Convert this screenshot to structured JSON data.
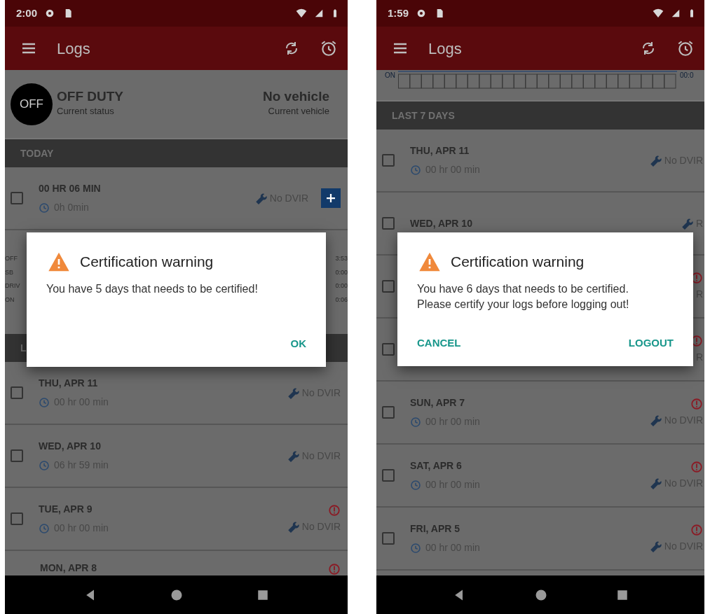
{
  "phones": [
    {
      "status_bar": {
        "time": "2:00"
      },
      "app_bar": {
        "title": "Logs"
      },
      "blocks": [
        {
          "kind": "status_card",
          "badge": "OFF",
          "status": "OFF DUTY",
          "status_caption": "Current status",
          "vehicle": "No vehicle",
          "vehicle_caption": "Current vehicle"
        },
        {
          "kind": "header",
          "text": "TODAY"
        },
        {
          "kind": "log_row",
          "date": "00 HR  06 MIN",
          "duration": "0h 0min",
          "dvir": "No DVIR",
          "alert": false,
          "checked": false,
          "add": true
        },
        {
          "kind": "summary_strip",
          "left_labels": [
            "OFF",
            "SB",
            "DRIV",
            "ON"
          ],
          "right_values": [
            "3:53",
            "0:00",
            "0:00",
            "0:06"
          ]
        },
        {
          "kind": "header",
          "text": "L"
        },
        {
          "kind": "log_row",
          "date": "THU, APR 11",
          "duration": "00 hr  00 min",
          "dvir": "No DVIR",
          "alert": false,
          "checked": false
        },
        {
          "kind": "log_row",
          "date": "WED, APR 10",
          "duration": "06 hr  59 min",
          "dvir": "No DVIR",
          "alert": false,
          "checked": false
        },
        {
          "kind": "log_row",
          "date": "TUE, APR 9",
          "duration": "00 hr  00 min",
          "dvir": "No DVIR",
          "alert": true,
          "checked": false
        },
        {
          "kind": "stub_row",
          "date": "MON, APR 8",
          "alert": true
        }
      ],
      "dialog": {
        "title": "Certification warning",
        "message_lines": [
          "You have 5 days that needs to be certified!"
        ],
        "buttons": [
          "OK"
        ]
      }
    },
    {
      "status_bar": {
        "time": "1:59"
      },
      "app_bar": {
        "title": "Logs"
      },
      "blocks": [
        {
          "kind": "chart_strip",
          "left_label": "ON",
          "right_label": "00:0"
        },
        {
          "kind": "header",
          "text": "LAST 7 DAYS"
        },
        {
          "kind": "log_row",
          "date": "THU, APR 11",
          "duration": "00 hr  00 min",
          "dvir": "No DVIR",
          "alert": false,
          "checked": false
        },
        {
          "kind": "log_row",
          "date": "WED, APR 10",
          "dvir": "R",
          "alert": false,
          "checked": false
        },
        {
          "kind": "log_row",
          "dvir": "R",
          "alert": true,
          "checked": false
        },
        {
          "kind": "log_row",
          "dvir": "R",
          "alert": true,
          "checked": false
        },
        {
          "kind": "log_row",
          "date": "SUN, APR 7",
          "duration": "00 hr  00 min",
          "dvir": "No DVIR",
          "alert": true,
          "checked": false
        },
        {
          "kind": "log_row",
          "date": "SAT, APR 6",
          "duration": "00 hr  00 min",
          "dvir": "No DVIR",
          "alert": true,
          "checked": false
        },
        {
          "kind": "log_row",
          "date": "FRI, APR 5",
          "duration": "00 hr  00 min",
          "dvir": "No DVIR",
          "alert": true,
          "checked": false
        }
      ],
      "dialog": {
        "title": "Certification warning",
        "message_lines": [
          "You have 6 days that needs to be certified.",
          "Please certify your logs before logging out!"
        ],
        "buttons": [
          "CANCEL",
          "LOGOUT"
        ]
      }
    }
  ]
}
